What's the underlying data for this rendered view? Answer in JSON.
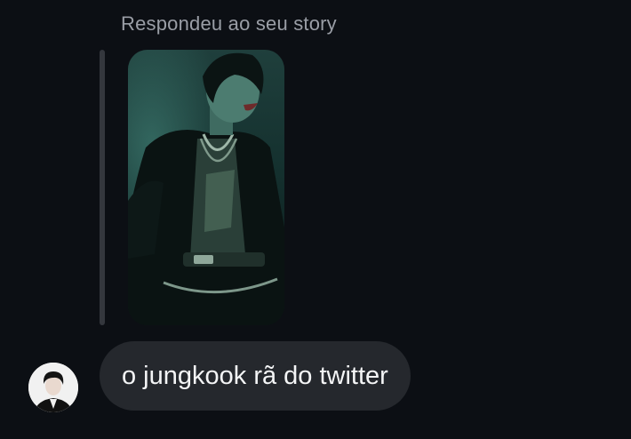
{
  "story_reply": {
    "label": "Respondeu ao seu story",
    "thumbnail_icon": "story-photo"
  },
  "message": {
    "text": "o jungkook rã do twitter",
    "sender_avatar_icon": "profile-photo"
  },
  "colors": {
    "background": "#0c0f14",
    "bubble": "#25282d",
    "quote_bar": "#34373d",
    "label_text": "#9a9ea6",
    "message_text": "#f4f5f6"
  }
}
